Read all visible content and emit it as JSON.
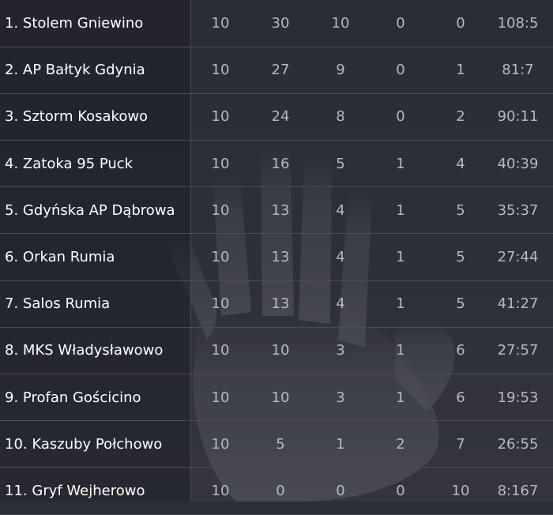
{
  "standings": {
    "rows": [
      {
        "rank": "1.",
        "team": "Stolem Gniewino",
        "played": "10",
        "points": "30",
        "won": "10",
        "drawn": "0",
        "lost": "0",
        "goals": "108:5"
      },
      {
        "rank": "2.",
        "team": "AP Bałtyk Gdynia",
        "played": "10",
        "points": "27",
        "won": "9",
        "drawn": "0",
        "lost": "1",
        "goals": "81:7"
      },
      {
        "rank": "3.",
        "team": "Sztorm Kosakowo",
        "played": "10",
        "points": "24",
        "won": "8",
        "drawn": "0",
        "lost": "2",
        "goals": "90:11"
      },
      {
        "rank": "4.",
        "team": "Zatoka 95 Puck",
        "played": "10",
        "points": "16",
        "won": "5",
        "drawn": "1",
        "lost": "4",
        "goals": "40:39"
      },
      {
        "rank": "5.",
        "team": "Gdyńska AP Dąbrowa",
        "played": "10",
        "points": "13",
        "won": "4",
        "drawn": "1",
        "lost": "5",
        "goals": "35:37"
      },
      {
        "rank": "6.",
        "team": "Orkan Rumia",
        "played": "10",
        "points": "13",
        "won": "4",
        "drawn": "1",
        "lost": "5",
        "goals": "27:44"
      },
      {
        "rank": "7.",
        "team": "Salos Rumia",
        "played": "10",
        "points": "13",
        "won": "4",
        "drawn": "1",
        "lost": "5",
        "goals": "41:27"
      },
      {
        "rank": "8.",
        "team": "MKS Władysławowo",
        "played": "10",
        "points": "10",
        "won": "3",
        "drawn": "1",
        "lost": "6",
        "goals": "27:57"
      },
      {
        "rank": "9.",
        "team": "Profan Gościcino",
        "played": "10",
        "points": "10",
        "won": "3",
        "drawn": "1",
        "lost": "6",
        "goals": "19:53"
      },
      {
        "rank": "10.",
        "team": "Kaszuby Połchowo",
        "played": "10",
        "points": "5",
        "won": "1",
        "drawn": "2",
        "lost": "7",
        "goals": "26:55"
      },
      {
        "rank": "11.",
        "team": "Gryf Wejherowo",
        "played": "10",
        "points": "0",
        "won": "0",
        "drawn": "0",
        "lost": "10",
        "goals": "8:167"
      }
    ]
  },
  "colors": {
    "background": "#2c2e38",
    "divider": "#4a4c56",
    "team_text": "#ffffff",
    "stat_text": "#b7b9c2"
  },
  "background_image": "hand-watermark"
}
